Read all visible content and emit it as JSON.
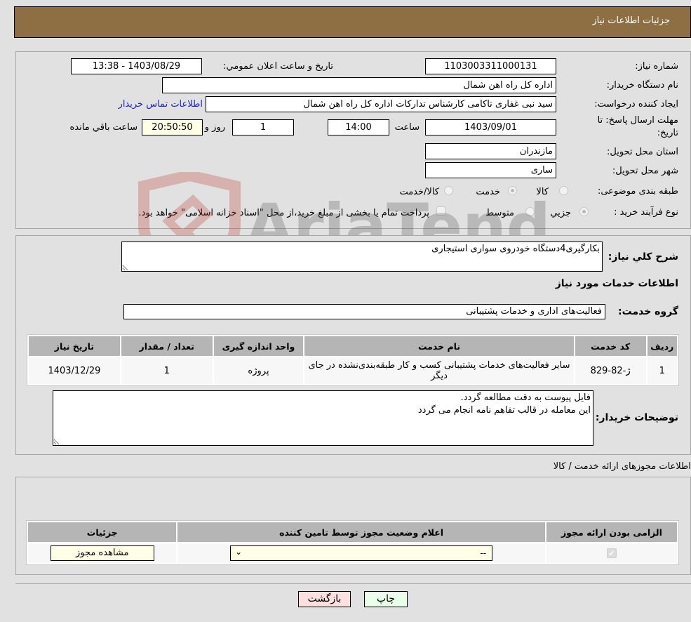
{
  "header": {
    "title": "جزئیات اطلاعات نیاز"
  },
  "form": {
    "need_number": {
      "label": "شماره نیاز:",
      "value": "1103003311000131"
    },
    "announce_datetime": {
      "label": "تاریخ و ساعت اعلان عمومي:",
      "value": "1403/08/29 - 13:38"
    },
    "buyer_org": {
      "label": "نام دستگاه خریدار:",
      "value": "اداره کل راه اهن شمال"
    },
    "requester": {
      "label": "ایجاد کننده درخواست:",
      "value": "سید نبی غفاری تاکامی کارشناس تدارکات اداره کل راه اهن شمال",
      "contact_link": "اطلاعات تماس خریدار"
    },
    "deadline": {
      "label_line1": "مهلت ارسال پاسخ: تا",
      "label_line2": "تاریخ:",
      "date": "1403/09/01",
      "time_label": "ساعت",
      "time": "14:00",
      "days": "1",
      "days_label": "روز و",
      "remaining": "20:50:50",
      "remaining_label": "ساعت باقي مانده"
    },
    "province": {
      "label": "استان محل تحویل:",
      "value": "مازندران"
    },
    "city": {
      "label": "شهر محل تحویل:",
      "value": "ساری"
    },
    "category": {
      "label": "طبقه بندی موضوعی:",
      "options": [
        {
          "label": "کالا",
          "checked": false
        },
        {
          "label": "خدمت",
          "checked": true
        },
        {
          "label": "کالا/خدمت",
          "checked": false
        }
      ]
    },
    "purchase_type": {
      "label": "نوع فرآیند خرید :",
      "options": [
        {
          "label": "جزيي",
          "checked": true
        },
        {
          "label": "متوسط",
          "checked": false
        }
      ],
      "treasury_checkbox_label": "پرداخت تمام یا بخشی از مبلغ خرید،از محل \"اسناد خزانه اسلامی\" خواهد بود.",
      "treasury_checked": false
    }
  },
  "description": {
    "label": "شرح كلي نياز:",
    "value": "بکارگیری4دستگاه خودروی سواری استیجاری"
  },
  "services_section_title": "اطلاعات خدمات مورد نياز",
  "service_group": {
    "label": "گروه خدمت:",
    "value": "فعالیت‌های اداری و خدمات پشتیبانی"
  },
  "services_table": {
    "headers": [
      "ردیف",
      "کد خدمت",
      "نام خدمت",
      "واحد اندازه گیری",
      "تعداد / مقدار",
      "تاریخ نیاز"
    ],
    "rows": [
      [
        "1",
        "ژ-82-829",
        "سایر فعالیت‌های خدمات پشتیبانی کسب و کار طبقه‌بندی‌نشده در جای دیگر",
        "پروژه",
        "1",
        "1403/12/29"
      ]
    ]
  },
  "buyer_notes": {
    "label": "توضیحات خریدار:",
    "value": "فایل پیوست به دقت مطالعه گردد.\nاین معامله در قالب تفاهم نامه انجام می گردد"
  },
  "permits_section_title": "اطلاعات مجوزهای ارائه خدمت / کالا",
  "permits_table": {
    "headers": [
      "الزامی بودن ارائه مجوز",
      "اعلام وضعیت مجوز توسط تامین کننده",
      "جزئیات"
    ],
    "rows": [
      {
        "required_checked": true,
        "status_selected": "--",
        "details_button": "مشاهده مجوز"
      }
    ]
  },
  "footer": {
    "back_button": "بازگشت",
    "print_button": "چاپ"
  },
  "watermark": {
    "text": "AriaTender.neT",
    "colors": {
      "shield": "#c0392b",
      "text": "#555555"
    }
  }
}
